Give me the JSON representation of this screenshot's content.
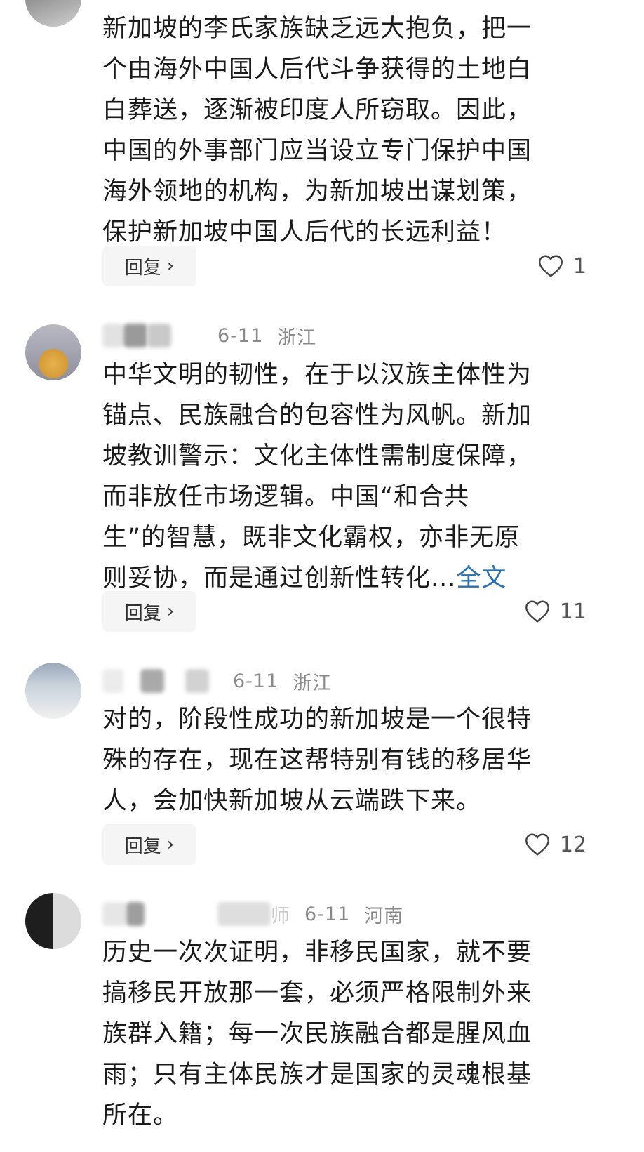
{
  "comments": [
    {
      "date": "",
      "location": "",
      "text": "新加坡的李氏家族缺乏远大抱负，把一\n个由海外中国人后代斗争获得的土地白\n白葬送，逐渐被印度人所窃取。因此，\n中国的外事部门应当设立专门保护中国\n海外领地的机构，为新加坡出谋划策，\n保护新加坡中国人后代的长远利益！",
      "more": "",
      "reply_label": "回复",
      "likes": "1"
    },
    {
      "date": "6-11",
      "location": "浙江",
      "text": "中华文明的韧性，在于以汉族主体性为\n锚点、民族融合的包容性为风帆。新加\n坡教训警示：文化主体性需制度保障，\n而非放任市场逻辑。中国“和合共\n生”的智慧，既非文化霸权，亦非无原\n则妥协，而是通过创新性转化...",
      "more": "全文",
      "reply_label": "回复",
      "likes": "11"
    },
    {
      "date": "6-11",
      "location": "浙江",
      "text": "对的，阶段性成功的新加坡是一个很特\n殊的存在，现在这帮特别有钱的移居华\n人，会加快新加坡从云端跌下来。",
      "more": "",
      "reply_label": "回复",
      "likes": "12"
    },
    {
      "name_fragment": "师",
      "date": "6-11",
      "location": "河南",
      "text": "历史一次次证明，非移民国家，就不要\n搞移民开放那一套，必须严格限制外来\n族群入籍；每一次民族融合都是腥风血\n雨；只有主体民族才是国家的灵魂根基\n所在。",
      "more": ""
    }
  ],
  "colors": {
    "text": "#1b1b1b",
    "meta": "#8a8a8a",
    "link": "#2b6fae",
    "reply_bg": "#f5f5f5"
  },
  "icons": [
    "heart-outline-icon",
    "chevron-right-icon"
  ]
}
